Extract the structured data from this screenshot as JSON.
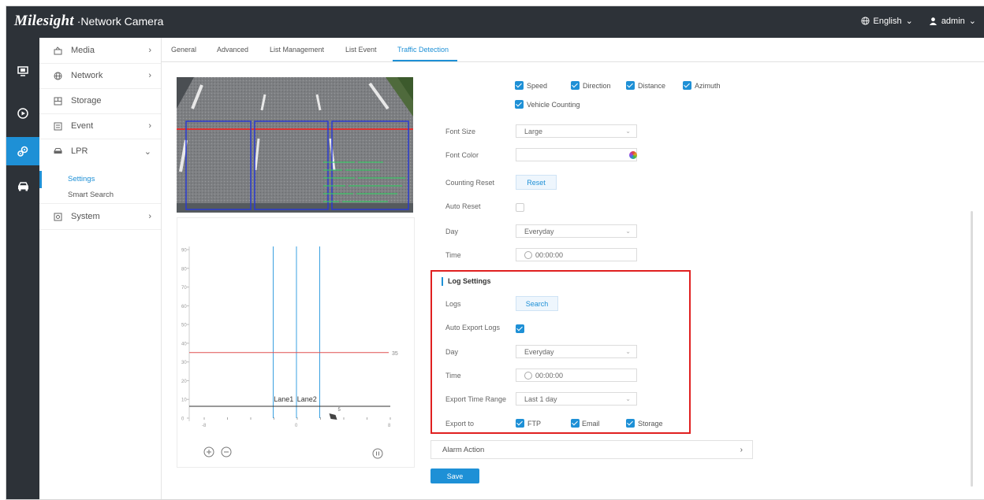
{
  "header": {
    "brand": "Milesight",
    "product": "·Network Camera",
    "language": "English",
    "user": "admin"
  },
  "rail": [
    "monitor-icon",
    "playback-icon",
    "settings-icon",
    "vehicle-icon"
  ],
  "menu": {
    "media": "Media",
    "network": "Network",
    "storage": "Storage",
    "event": "Event",
    "lpr": "LPR",
    "lpr_settings": "Settings",
    "lpr_smart_search": "Smart Search",
    "system": "System"
  },
  "tabs": {
    "general": "General",
    "advanced": "Advanced",
    "list_management": "List Management",
    "list_event": "List Event",
    "traffic_detection": "Traffic Detection"
  },
  "overlay_items": {
    "speed": "Speed",
    "direction": "Direction",
    "distance": "Distance",
    "azimuth": "Azimuth",
    "vehicle_counting": "Vehicle Counting"
  },
  "form": {
    "font_size_label": "Font Size",
    "font_size_value": "Large",
    "font_color_label": "Font Color",
    "counting_reset_label": "Counting Reset",
    "reset_button": "Reset",
    "auto_reset_label": "Auto Reset",
    "day_label": "Day",
    "day_value": "Everyday",
    "time_label": "Time",
    "time_value": "00:00:00"
  },
  "log_settings": {
    "title": "Log Settings",
    "logs_label": "Logs",
    "search_button": "Search",
    "auto_export_label": "Auto Export Logs",
    "day_label": "Day",
    "day_value": "Everyday",
    "time_label": "Time",
    "time_value": "00:00:00",
    "export_range_label": "Export Time Range",
    "export_range_value": "Last 1 day",
    "export_to_label": "Export to",
    "ftp": "FTP",
    "email": "Email",
    "storage": "Storage"
  },
  "alarm_action": "Alarm Action",
  "save_button": "Save",
  "chart_data": {
    "type": "line",
    "yticks": [
      "0",
      "10",
      "20",
      "30",
      "40",
      "50",
      "60",
      "70",
      "80",
      "90"
    ],
    "xticks": [
      "-8",
      "0",
      "8"
    ],
    "ylim": [
      0,
      90
    ],
    "xlim": [
      -8,
      8
    ],
    "lanes": [
      "Lane1",
      "Lane2"
    ],
    "lane_lines_x": [
      -2,
      0,
      2
    ],
    "threshold_line": {
      "y": 35,
      "label": "35"
    },
    "target_marker": {
      "label": "5"
    }
  }
}
